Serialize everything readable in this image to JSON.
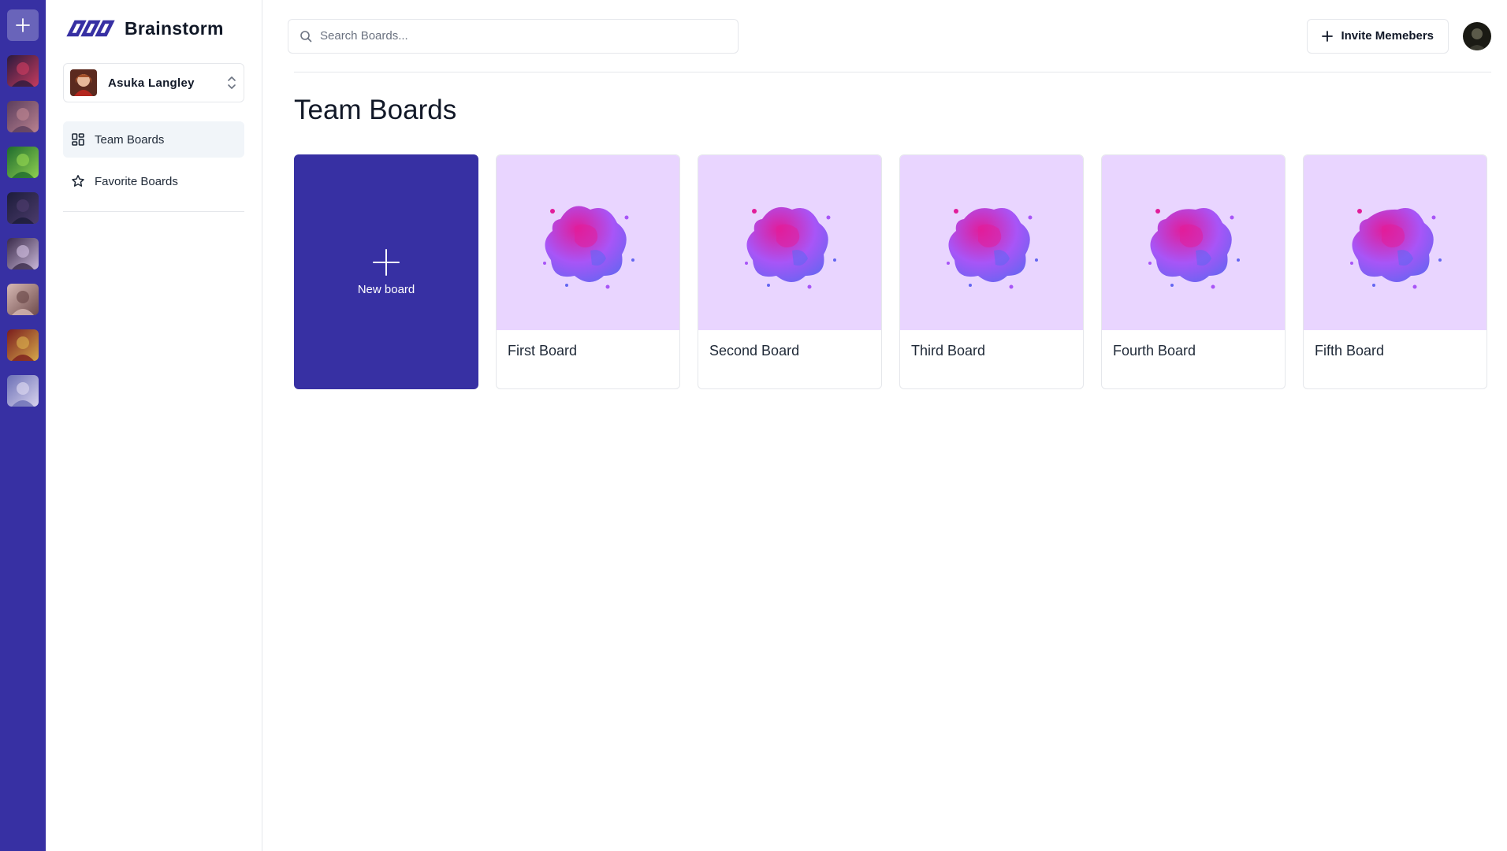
{
  "app": {
    "name": "Brainstorm"
  },
  "rail": {
    "orgs": [
      {
        "name": "org-1",
        "colors": [
          "#2b1a3d",
          "#c53b5e"
        ]
      },
      {
        "name": "org-2",
        "colors": [
          "#5a3d5c",
          "#b9818f"
        ]
      },
      {
        "name": "org-3",
        "colors": [
          "#1e6b2e",
          "#8fd14f"
        ]
      },
      {
        "name": "org-4",
        "colors": [
          "#1c1c3a",
          "#4b3b6b"
        ]
      },
      {
        "name": "org-5",
        "colors": [
          "#3a2a4a",
          "#c9b7d8"
        ]
      },
      {
        "name": "org-6",
        "colors": [
          "#d7b9b4",
          "#6e4b4b"
        ]
      },
      {
        "name": "org-7",
        "colors": [
          "#7a1d1d",
          "#d6a84a"
        ]
      },
      {
        "name": "org-8",
        "colors": [
          "#6b6fb5",
          "#d9d4ee"
        ]
      }
    ]
  },
  "sidebar": {
    "org_switcher": {
      "name": "Asuka Langley"
    },
    "nav": [
      {
        "label": "Team Boards",
        "icon": "dashboard-icon",
        "active": true
      },
      {
        "label": "Favorite Boards",
        "icon": "star-icon",
        "active": false
      }
    ]
  },
  "topbar": {
    "search_placeholder": "Search Boards...",
    "invite_label": "Invite Memebers"
  },
  "main": {
    "title": "Team Boards",
    "new_board_label": "New board",
    "boards": [
      {
        "title": "First Board"
      },
      {
        "title": "Second Board"
      },
      {
        "title": "Third Board"
      },
      {
        "title": "Fourth Board"
      },
      {
        "title": "Fifth Board"
      }
    ]
  },
  "colors": {
    "accent": "#3730a3",
    "thumb_bg": "#e9d5ff",
    "blob_pink": "#e11d9a",
    "blob_purple": "#a855f7",
    "blob_blue": "#6366f1"
  }
}
